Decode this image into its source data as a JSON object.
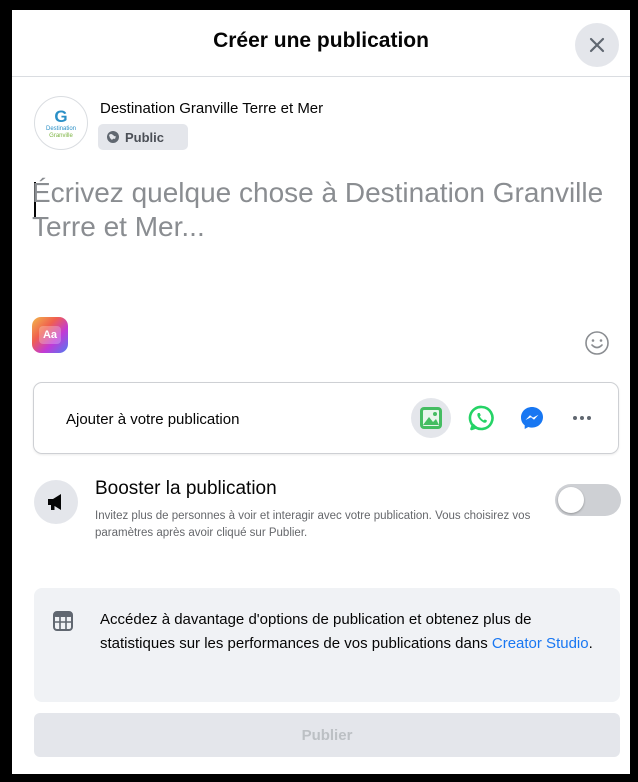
{
  "dialog": {
    "title": "Créer une publication"
  },
  "author": {
    "avatar_letter": "G",
    "avatar_brand_line1": "Destination",
    "avatar_brand_line2": "Granville",
    "name": "Destination Granville Terre et Mer",
    "privacy_label": "Public"
  },
  "composer": {
    "placeholder": "Écrivez quelque chose à Destination Granville Terre et Mer...",
    "value": ""
  },
  "tools": {
    "background_label": "Aa"
  },
  "add_to_post": {
    "label": "Ajouter à votre publication",
    "icons": [
      "photo-icon",
      "whatsapp-icon",
      "messenger-icon",
      "more-icon"
    ]
  },
  "boost": {
    "title": "Booster la publication",
    "description": "Invitez plus de personnes à voir et interagir avec votre publication. Vous choisirez vos paramètres après avoir cliqué sur Publier.",
    "enabled": false
  },
  "info": {
    "text": "Accédez à davantage d'options de publication et obtenez plus de statistiques sur les performances de vos publications dans ",
    "link_label": "Creator Studio",
    "suffix": "."
  },
  "actions": {
    "publish_label": "Publier"
  },
  "colors": {
    "accent": "#1877f2",
    "whatsapp": "#25d366",
    "photo": "#45bd62",
    "disabled_text": "#bcc0c4"
  }
}
